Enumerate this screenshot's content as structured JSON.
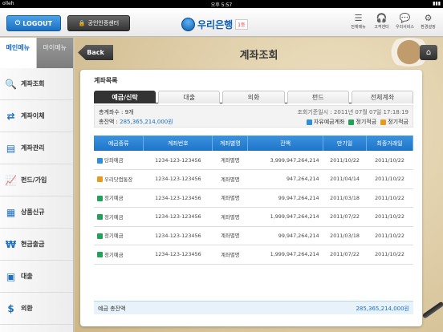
{
  "statusbar": {
    "carrier": "olleh",
    "time": "오후 5:57",
    "battery": "▮▮▮"
  },
  "header": {
    "logout_label": "LOGOUT",
    "cert_label": "공인인증센터",
    "logo_name": "우리은행",
    "logo_badge": "1등",
    "menu": [
      {
        "label": "전체메뉴",
        "icon": "menu-icon"
      },
      {
        "label": "고객센터",
        "icon": "headset-icon"
      },
      {
        "label": "우리서비스",
        "icon": "chat-icon"
      },
      {
        "label": "환경설정",
        "icon": "gear-icon"
      }
    ]
  },
  "sidebar": {
    "tabs": [
      {
        "label": "메인메뉴"
      },
      {
        "label": "마이메뉴"
      }
    ],
    "items": [
      {
        "label": "계좌조회",
        "icon": "magnifier-icon"
      },
      {
        "label": "계좌이체",
        "icon": "transfer-icon"
      },
      {
        "label": "계좌관리",
        "icon": "account-manage-icon"
      },
      {
        "label": "펀드/가입",
        "icon": "chart-icon"
      },
      {
        "label": "상품신규",
        "icon": "calendar-icon"
      },
      {
        "label": "현금출금",
        "icon": "cash-icon"
      },
      {
        "label": "대출",
        "icon": "loan-icon"
      },
      {
        "label": "외환",
        "icon": "dollar-icon"
      }
    ]
  },
  "main": {
    "back_label": "Back",
    "title": "계좌조회",
    "panel_heading": "계좌목록",
    "tabs": [
      {
        "label": "예금/신탁",
        "active": true
      },
      {
        "label": "대출",
        "active": false
      },
      {
        "label": "외화",
        "active": false
      },
      {
        "label": "펀드",
        "active": false
      },
      {
        "label": "전체계좌",
        "active": false
      }
    ],
    "summary": {
      "count_text": "총계좌수 : 9개",
      "total_label": "총잔액 :",
      "total_amount": "285,365,214,000원",
      "date_text": "조회기준일시 : 2011년 07월 07일 17:18:19",
      "legend": [
        {
          "label": "자유예금계좌",
          "color": "#2c8fd8"
        },
        {
          "label": "정기적금",
          "color": "#23a05a"
        },
        {
          "label": "정기적금",
          "color": "#e79a1f"
        }
      ]
    },
    "table": {
      "headers": [
        "예금종류",
        "계좌번호",
        "계좌별명",
        "잔액",
        "만기일",
        "최종거래일"
      ],
      "rows": [
        {
          "type": "당좌예금",
          "color": "#2c8fd8",
          "number": "1234-123-123456",
          "alias": "계좌별명",
          "balance": "3,999,947,264,214",
          "maturity": "2011/10/22",
          "last": "2011/10/22"
        },
        {
          "type": "우리닷컴통장",
          "color": "#e79a1f",
          "number": "1234-123-123456",
          "alias": "계좌별명",
          "balance": "947,264,214",
          "maturity": "2011/04/14",
          "last": "2011/10/22"
        },
        {
          "type": "정기예금",
          "color": "#23a05a",
          "number": "1234-123-123456",
          "alias": "계좌별명",
          "balance": "99,947,264,214",
          "maturity": "2011/03/18",
          "last": "2011/10/22"
        },
        {
          "type": "정기예금",
          "color": "#23a05a",
          "number": "1234-123-123456",
          "alias": "계좌별명",
          "balance": "1,999,947,264,214",
          "maturity": "2011/07/22",
          "last": "2011/10/22"
        },
        {
          "type": "정기예금",
          "color": "#23a05a",
          "number": "1234-123-123456",
          "alias": "계좌별명",
          "balance": "99,947,264,214",
          "maturity": "2011/03/18",
          "last": "2011/10/22"
        },
        {
          "type": "정기예금",
          "color": "#23a05a",
          "number": "1234-123-123456",
          "alias": "계좌별명",
          "balance": "1,999,947,264,214",
          "maturity": "2011/07/22",
          "last": "2011/10/22"
        }
      ],
      "total_label": "예금 총잔액",
      "total_value": "285,365,214,000원"
    }
  },
  "colors": {
    "accent": "#1c6fc4",
    "header_blue": "#2a84d6"
  }
}
